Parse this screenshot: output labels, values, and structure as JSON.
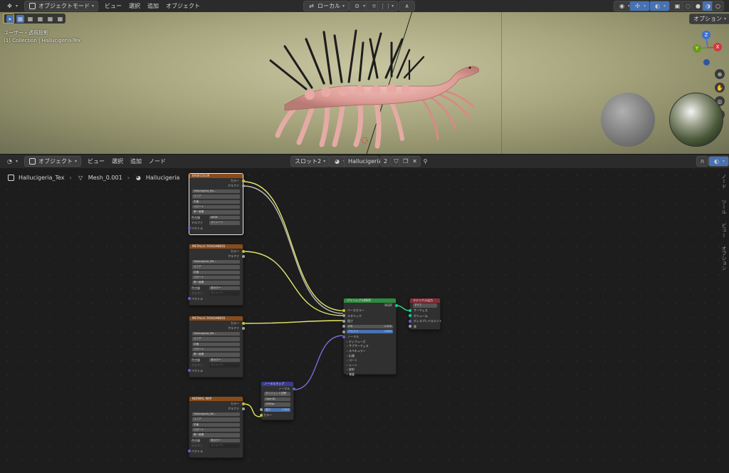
{
  "viewport_header": {
    "mode": "オブジェクトモード",
    "menu": [
      "ビュー",
      "選択",
      "追加",
      "オブジェクト"
    ],
    "transform_orientation": "ローカル",
    "options": "オプション"
  },
  "viewport": {
    "view_label": "ユーザー・透視投影",
    "collection_label": "(1) Collection | Hallucigeria-Tex",
    "gizmo_axes": [
      "Z",
      "Y",
      "X"
    ]
  },
  "node_header": {
    "mode": "オブジェクト",
    "menu": [
      "ビュー",
      "選択",
      "追加",
      "ノード"
    ],
    "slot": "スロット2",
    "material": "Hallucigeria",
    "user_count": "2"
  },
  "breadcrumb": {
    "object": "Hallucigeria_Tex",
    "mesh": "Mesh_0.001",
    "material": "Hallucigeria"
  },
  "side_tabs": [
    "ノード",
    "ツール",
    "ビュー",
    "オプション"
  ],
  "nodes": {
    "basecolor": {
      "title": "BASECOLOR",
      "out_color": "カラー",
      "out_alpha": "アルファ",
      "image": "Hallucigeria_Bo...",
      "interp": "リニア",
      "proj": "平面",
      "ext": "リピート",
      "frame": "単一画像",
      "colorspace_label": "色空間",
      "colorspace": "sRGB",
      "alpha_label": "アルファ",
      "alpha": "ストレート",
      "in_vector": "ベクトル"
    },
    "metal1": {
      "title": "METALLIC ROUGHNESS",
      "out_color": "カラー",
      "out_alpha": "アルファ",
      "image": "Hallucigeria_Me...",
      "interp": "リニア",
      "proj": "平面",
      "ext": "リピート",
      "frame": "単一画像",
      "colorspace_label": "色空間",
      "colorspace": "非カラー",
      "alpha_label": "アルファ",
      "alpha": "ストレート",
      "in_vector": "ベクトル"
    },
    "metal2": {
      "title": "METALLIC ROUGHNESS",
      "out_color": "カラー",
      "out_alpha": "アルファ",
      "image": "Hallucigeria_Me...",
      "interp": "リニア",
      "proj": "平面",
      "ext": "リピート",
      "frame": "単一画像",
      "colorspace_label": "色空間",
      "colorspace": "非カラー",
      "alpha_label": "アルファ",
      "alpha": "ストレート",
      "in_vector": "ベクトル"
    },
    "normal": {
      "title": "NORMAL MAP",
      "out_color": "カラー",
      "out_alpha": "アルファ",
      "image": "Hallucigeria_No...",
      "interp": "リニア",
      "proj": "平面",
      "ext": "リピート",
      "frame": "単一画像",
      "colorspace_label": "色空間",
      "colorspace": "非カラー",
      "alpha_label": "アルファ",
      "alpha": "ストレート",
      "in_vector": "ベクトル"
    },
    "normalmap": {
      "title": "ノーマルマップ",
      "out_normal": "ノーマル",
      "space": "タンジェント空間",
      "convention": "OpenGL",
      "uv": "UVMap",
      "strength_label": "強さ",
      "strength": "1.000",
      "in_color": "カラー"
    },
    "bsdf": {
      "title": "プリンシプルBSDF",
      "out_bsdf": "BSDF",
      "base_color": "ベースカラー",
      "metallic": "メタリック",
      "roughness": "粗さ",
      "ior_label": "IOR",
      "ior": "1.500",
      "alpha_label": "アルファ",
      "alpha": "1.000",
      "normal": "ノーマル",
      "panels": [
        "ディフューズ",
        "サブサーフェス",
        "スペキュラー",
        "伝播",
        "コート",
        "シーン",
        "放射",
        "薄膜"
      ]
    },
    "output": {
      "title": "マテリアル出力",
      "target": "すべて",
      "surface": "サーフェス",
      "volume": "ボリューム",
      "displacement": "ディスプレイスメント",
      "thickness": "厚"
    }
  },
  "colors": {
    "texture_header": "#8a4b1a",
    "shader_header": "#2e8b3e",
    "vector_header": "#3b3b8f",
    "output_header": "#8a2c36",
    "link_yellow": "#e6e66a",
    "link_gray": "#bdbdbd",
    "link_purple": "#7b6bd6",
    "link_green": "#3be07a"
  }
}
